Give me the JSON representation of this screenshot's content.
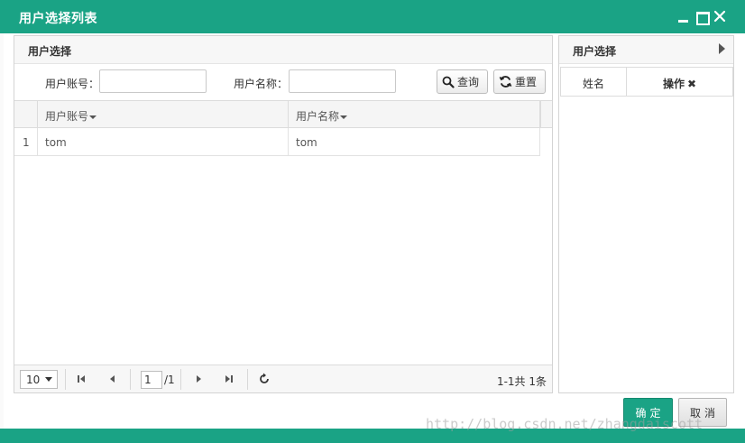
{
  "window": {
    "title": "用户选择列表"
  },
  "left_panel": {
    "title": "用户选择",
    "search": {
      "account_label": "用户账号：",
      "account_value": "",
      "name_label": "用户名称：",
      "name_value": "",
      "query_label": "查询",
      "reset_label": "重置"
    },
    "grid": {
      "columns": [
        "用户账号",
        "用户名称"
      ],
      "rows": [
        {
          "index": "1",
          "account": "tom",
          "name": "tom"
        }
      ]
    },
    "pager": {
      "page_size": "10",
      "current_page": "1",
      "total_pages": "/1",
      "info": "1-1共 1条"
    }
  },
  "right_panel": {
    "title": "用户选择",
    "columns": [
      "姓名",
      "操作"
    ]
  },
  "footer": {
    "ok_label": "确定",
    "cancel_label": "取消"
  },
  "watermark": "http://blog.csdn.net/zhangdaiscott"
}
